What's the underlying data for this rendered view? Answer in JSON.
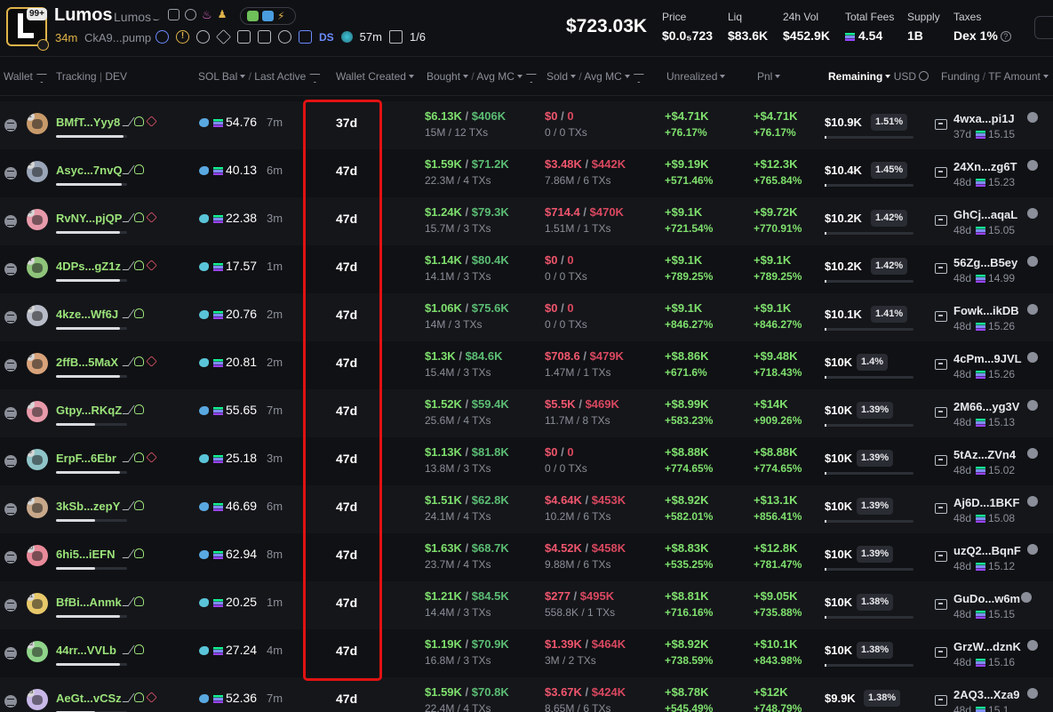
{
  "token": {
    "logo_letter": "L",
    "logo_badge": "99+",
    "name": "Lumos",
    "symbol": "Lumos",
    "age": "34m",
    "address": "CkA9...pump",
    "ds_label": "DS",
    "time_label": "57m",
    "count_label": "1/6"
  },
  "stats": {
    "market_cap": "$723.03K",
    "price_label": "Price",
    "price_value": "$0.0₅723",
    "liq_label": "Liq",
    "liq_value": "$83.6K",
    "vol_label": "24h Vol",
    "vol_value": "$452.9K",
    "fees_label": "Total Fees",
    "fees_value": "4.54",
    "supply_label": "Supply",
    "supply_value": "1B",
    "taxes_label": "Taxes",
    "taxes_value": "Dex 1%"
  },
  "columns": {
    "wallet": "Wallet",
    "tracking": "Tracking",
    "dev": "DEV",
    "sol_bal": "SOL Bal",
    "last_active": "Last Active",
    "wallet_created": "Wallet Created",
    "bought": "Bought",
    "avg_mc": "Avg MC",
    "sold": "Sold",
    "avg_mc2": "Avg MC",
    "unrealized": "Unrealized",
    "pnl": "Pnl",
    "remaining": "Remaining",
    "usd": "USD",
    "funding": "Funding",
    "tf_amount": "TF Amount"
  },
  "colors": {
    "accent_green": "#7fe06e",
    "accent_red": "#f0566e",
    "highlight": "#e01212",
    "gold": "#e0b44a"
  },
  "rows": [
    {
      "rank": "1",
      "avatar_color": "#c89a6a",
      "name": "BMfT...Yyy8",
      "has_stack": true,
      "progress": 0.95,
      "mammal": "dolphin",
      "sol": "54.76",
      "active": "7m",
      "created": "37d",
      "bought": "$6.13K",
      "bought_mc": "$406K",
      "bought_sub": "15M / 12 TXs",
      "sold": "$0",
      "sold_mc": "0",
      "sold_sub": "0 / 0 TXs",
      "unreal": "+$4.71K",
      "unreal_pct": "+76.17%",
      "pnl": "+$4.71K",
      "pnl_pct": "+76.17%",
      "remain": "$10.9K",
      "remain_pct": "1.51%",
      "f_addr": "4wxa...pi1J",
      "f_age": "37d",
      "f_amt": "15.15"
    },
    {
      "rank": "2",
      "avatar_color": "#9aa6b8",
      "name": "Asyc...7nvQ",
      "has_stack": false,
      "progress": 0.93,
      "mammal": "dolphin",
      "sol": "40.13",
      "active": "6m",
      "created": "47d",
      "bought": "$1.59K",
      "bought_mc": "$71.2K",
      "bought_sub": "22.3M / 4 TXs",
      "sold": "$3.48K",
      "sold_mc": "$442K",
      "sold_sub": "7.86M / 6 TXs",
      "unreal": "+$9.19K",
      "unreal_pct": "+571.46%",
      "pnl": "+$12.3K",
      "pnl_pct": "+765.84%",
      "remain": "$10.4K",
      "remain_pct": "1.45%",
      "f_addr": "24Xn...zg6T",
      "f_age": "48d",
      "f_amt": "15.23"
    },
    {
      "rank": "3",
      "avatar_color": "#e89aaa",
      "name": "RvNY...pjQP",
      "has_stack": true,
      "progress": 0.9,
      "mammal": "fish",
      "sol": "22.38",
      "active": "3m",
      "created": "47d",
      "bought": "$1.24K",
      "bought_mc": "$79.3K",
      "bought_sub": "15.7M / 3 TXs",
      "sold": "$714.4",
      "sold_mc": "$470K",
      "sold_sub": "1.51M / 1 TXs",
      "unreal": "+$9.1K",
      "unreal_pct": "+721.54%",
      "pnl": "+$9.72K",
      "pnl_pct": "+770.91%",
      "remain": "$10.2K",
      "remain_pct": "1.42%",
      "f_addr": "GhCj...aqaL",
      "f_age": "48d",
      "f_amt": "15.05"
    },
    {
      "rank": "4",
      "avatar_color": "#8fc47a",
      "name": "4DPs...gZ1z",
      "has_stack": true,
      "progress": 0.9,
      "mammal": "fish",
      "sol": "17.57",
      "active": "1m",
      "created": "47d",
      "bought": "$1.14K",
      "bought_mc": "$80.4K",
      "bought_sub": "14.1M / 3 TXs",
      "sold": "$0",
      "sold_mc": "0",
      "sold_sub": "0 / 0 TXs",
      "unreal": "+$9.1K",
      "unreal_pct": "+789.25%",
      "pnl": "+$9.1K",
      "pnl_pct": "+789.25%",
      "remain": "$10.2K",
      "remain_pct": "1.42%",
      "f_addr": "56Zg...B5ey",
      "f_age": "48d",
      "f_amt": "14.99"
    },
    {
      "rank": "5",
      "avatar_color": "#b8bcc8",
      "name": "4kze...Wf6J",
      "has_stack": false,
      "progress": 0.9,
      "mammal": "fish",
      "sol": "20.76",
      "active": "2m",
      "created": "47d",
      "bought": "$1.06K",
      "bought_mc": "$75.6K",
      "bought_sub": "14M / 3 TXs",
      "sold": "$0",
      "sold_mc": "0",
      "sold_sub": "0 / 0 TXs",
      "unreal": "+$9.1K",
      "unreal_pct": "+846.27%",
      "pnl": "+$9.1K",
      "pnl_pct": "+846.27%",
      "remain": "$10.1K",
      "remain_pct": "1.41%",
      "f_addr": "Fowk...ikDB",
      "f_age": "48d",
      "f_amt": "15.26"
    },
    {
      "rank": "6",
      "avatar_color": "#d8a27a",
      "name": "2ffB...5MaX",
      "has_stack": true,
      "progress": 0.9,
      "mammal": "fish",
      "sol": "20.81",
      "active": "2m",
      "created": "47d",
      "bought": "$1.3K",
      "bought_mc": "$84.6K",
      "bought_sub": "15.4M / 3 TXs",
      "sold": "$708.6",
      "sold_mc": "$479K",
      "sold_sub": "1.47M / 1 TXs",
      "unreal": "+$8.86K",
      "unreal_pct": "+671.6%",
      "pnl": "+$9.48K",
      "pnl_pct": "+718.43%",
      "remain": "$10K",
      "remain_pct": "1.4%",
      "f_addr": "4cPm...9JVL",
      "f_age": "48d",
      "f_amt": "15.26"
    },
    {
      "rank": "7",
      "avatar_color": "#e89aaa",
      "name": "Gtpy...RKqZ",
      "has_stack": false,
      "progress": 0.55,
      "mammal": "dolphin",
      "sol": "55.65",
      "active": "7m",
      "created": "47d",
      "bought": "$1.52K",
      "bought_mc": "$59.4K",
      "bought_sub": "25.6M / 4 TXs",
      "sold": "$5.5K",
      "sold_mc": "$469K",
      "sold_sub": "11.7M / 8 TXs",
      "unreal": "+$8.99K",
      "unreal_pct": "+583.23%",
      "pnl": "+$14K",
      "pnl_pct": "+909.26%",
      "remain": "$10K",
      "remain_pct": "1.39%",
      "f_addr": "2M66...yg3V",
      "f_age": "48d",
      "f_amt": "15.13"
    },
    {
      "rank": "8",
      "avatar_color": "#8fc4c8",
      "name": "ErpF...6Ebr",
      "has_stack": true,
      "progress": 0.9,
      "mammal": "fish",
      "sol": "25.18",
      "active": "3m",
      "created": "47d",
      "bought": "$1.13K",
      "bought_mc": "$81.8K",
      "bought_sub": "13.8M / 3 TXs",
      "sold": "$0",
      "sold_mc": "0",
      "sold_sub": "0 / 0 TXs",
      "unreal": "+$8.88K",
      "unreal_pct": "+774.65%",
      "pnl": "+$8.88K",
      "pnl_pct": "+774.65%",
      "remain": "$10K",
      "remain_pct": "1.39%",
      "f_addr": "5tAz...ZVn4",
      "f_age": "48d",
      "f_amt": "15.02"
    },
    {
      "rank": "9",
      "avatar_color": "#c8a88a",
      "name": "3kSb...zepY",
      "has_stack": false,
      "progress": 0.55,
      "mammal": "dolphin",
      "sol": "46.69",
      "active": "6m",
      "created": "47d",
      "bought": "$1.51K",
      "bought_mc": "$62.8K",
      "bought_sub": "24.1M / 4 TXs",
      "sold": "$4.64K",
      "sold_mc": "$453K",
      "sold_sub": "10.2M / 6 TXs",
      "unreal": "+$8.92K",
      "unreal_pct": "+582.01%",
      "pnl": "+$13.1K",
      "pnl_pct": "+856.41%",
      "remain": "$10K",
      "remain_pct": "1.39%",
      "f_addr": "Aj6D...1BKF",
      "f_age": "48d",
      "f_amt": "15.08"
    },
    {
      "rank": "10",
      "avatar_color": "#e88a9a",
      "name": "6hi5...iEFN",
      "has_stack": false,
      "progress": 0.55,
      "mammal": "dolphin",
      "sol": "62.94",
      "active": "8m",
      "created": "47d",
      "bought": "$1.63K",
      "bought_mc": "$68.7K",
      "bought_sub": "23.7M / 4 TXs",
      "sold": "$4.52K",
      "sold_mc": "$458K",
      "sold_sub": "9.88M / 6 TXs",
      "unreal": "+$8.83K",
      "unreal_pct": "+535.25%",
      "pnl": "+$12.8K",
      "pnl_pct": "+781.47%",
      "remain": "$10K",
      "remain_pct": "1.39%",
      "f_addr": "uzQ2...BqnF",
      "f_age": "48d",
      "f_amt": "15.12"
    },
    {
      "rank": "11",
      "avatar_color": "#e8c86a",
      "name": "BfBi...Anmk",
      "has_stack": false,
      "progress": 0.9,
      "mammal": "fish",
      "sol": "20.25",
      "active": "1m",
      "created": "47d",
      "bought": "$1.21K",
      "bought_mc": "$84.5K",
      "bought_sub": "14.4M / 3 TXs",
      "sold": "$277",
      "sold_mc": "$495K",
      "sold_sub": "558.8K / 1 TXs",
      "unreal": "+$8.81K",
      "unreal_pct": "+716.16%",
      "pnl": "+$9.05K",
      "pnl_pct": "+735.88%",
      "remain": "$10K",
      "remain_pct": "1.38%",
      "f_addr": "GuDo...w6m",
      "f_age": "48d",
      "f_amt": "15.15"
    },
    {
      "rank": "12",
      "avatar_color": "#8fd48a",
      "name": "44rr...VVLb",
      "has_stack": false,
      "progress": 0.9,
      "mammal": "fish",
      "sol": "27.24",
      "active": "4m",
      "created": "47d",
      "bought": "$1.19K",
      "bought_mc": "$70.9K",
      "bought_sub": "16.8M / 3 TXs",
      "sold": "$1.39K",
      "sold_mc": "$464K",
      "sold_sub": "3M / 2 TXs",
      "unreal": "+$8.92K",
      "unreal_pct": "+738.59%",
      "pnl": "+$10.1K",
      "pnl_pct": "+843.98%",
      "remain": "$10K",
      "remain_pct": "1.38%",
      "f_addr": "GrzW...dznK",
      "f_age": "48d",
      "f_amt": "15.16"
    },
    {
      "rank": "13",
      "avatar_color": "#c8b8e8",
      "name": "AeGt...vCSz",
      "has_stack": true,
      "progress": 0.55,
      "mammal": "dolphin",
      "sol": "52.36",
      "active": "7m",
      "created": "47d",
      "bought": "$1.59K",
      "bought_mc": "$70.8K",
      "bought_sub": "22.4M / 4 TXs",
      "sold": "$3.67K",
      "sold_mc": "$424K",
      "sold_sub": "8.65M / 6 TXs",
      "unreal": "+$8.78K",
      "unreal_pct": "+545.49%",
      "pnl": "+$12K",
      "pnl_pct": "+748.79%",
      "remain": "$9.9K",
      "remain_pct": "1.38%",
      "f_addr": "2AQ3...Xza9",
      "f_age": "48d",
      "f_amt": "15.1"
    }
  ]
}
